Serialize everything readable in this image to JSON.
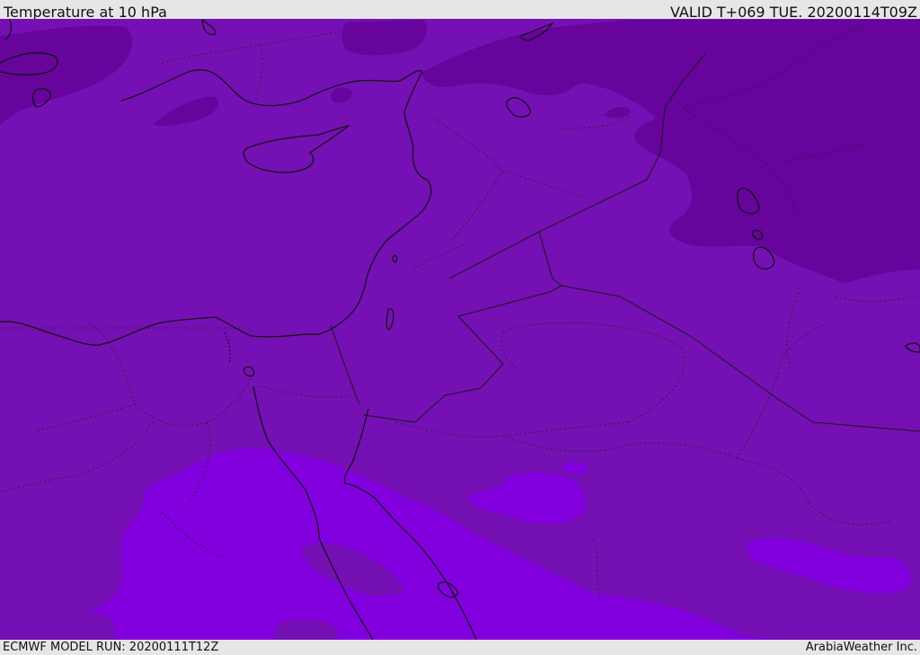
{
  "header": {
    "title": "Temperature at 10 hPa",
    "valid": "VALID T+069 TUE. 20200114T09Z"
  },
  "footer": {
    "model_run": "ECMWF MODEL RUN: 20200111T12Z",
    "credit": "ArabiaWeather Inc."
  },
  "colors": {
    "base": "#7510b4",
    "cold": "#66049c",
    "warm": "#8200dd",
    "coast": "#111111",
    "border": "#1a1a1a"
  }
}
